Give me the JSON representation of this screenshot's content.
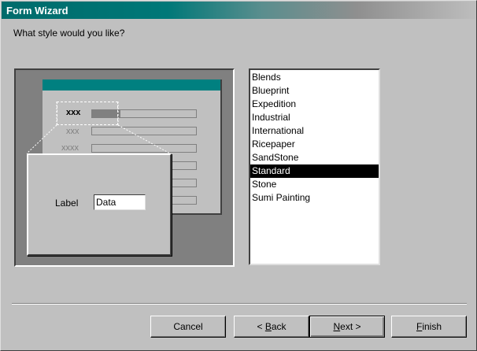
{
  "window": {
    "title": "Form Wizard"
  },
  "prompt": "What style would you like?",
  "preview": {
    "rows": [
      {
        "label": "xxx"
      },
      {
        "label": "xxx"
      },
      {
        "label": "xxxx"
      }
    ],
    "zoom_label": "Label",
    "zoom_data": "Data"
  },
  "styles": {
    "items": [
      "Blends",
      "Blueprint",
      "Expedition",
      "Industrial",
      "International",
      "Ricepaper",
      "SandStone",
      "Standard",
      "Stone",
      "Sumi Painting"
    ],
    "selected": "Standard"
  },
  "buttons": {
    "cancel": "Cancel",
    "back_accel": "B",
    "back_rest": "ack",
    "back_prefix": "< ",
    "next_accel": "N",
    "next_rest": "ext >",
    "finish_accel": "F",
    "finish_rest": "inish"
  },
  "colors": {
    "title_start": "#006b6b",
    "form_header": "#008080",
    "face": "#c0c0c0"
  }
}
